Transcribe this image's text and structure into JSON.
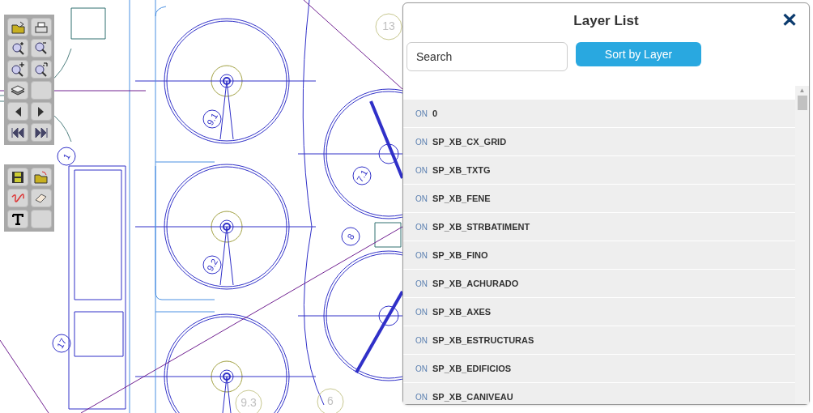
{
  "drawing_labels": [
    {
      "text": "9.1",
      "kind": "circled"
    },
    {
      "text": "9.2",
      "kind": "circled"
    },
    {
      "text": "9.3",
      "kind": "faint"
    },
    {
      "text": "7.1",
      "kind": "circled"
    },
    {
      "text": "8",
      "kind": "circled"
    },
    {
      "text": "1",
      "kind": "circled"
    },
    {
      "text": "17",
      "kind": "circled"
    },
    {
      "text": "13",
      "kind": "faint"
    },
    {
      "text": "6",
      "kind": "faint"
    }
  ],
  "layer_panel": {
    "title": "Layer List",
    "close": "✕",
    "search": {
      "placeholder": "Search"
    },
    "sort_button": "Sort by Layer",
    "scroll_up": "▲",
    "layers": [
      {
        "state": "ON",
        "name": "0"
      },
      {
        "state": "ON",
        "name": "SP_XB_CX_GRID"
      },
      {
        "state": "ON",
        "name": "SP_XB_TXTG"
      },
      {
        "state": "ON",
        "name": "SP_XB_FENE"
      },
      {
        "state": "ON",
        "name": "SP_XB_STRBATIMENT"
      },
      {
        "state": "ON",
        "name": "SP_XB_FINO"
      },
      {
        "state": "ON",
        "name": "SP_XB_ACHURADO"
      },
      {
        "state": "ON",
        "name": "SP_XB_AXES"
      },
      {
        "state": "ON",
        "name": "SP_XB_ESTRUCTURAS"
      },
      {
        "state": "ON",
        "name": "SP_XB_EDIFICIOS"
      },
      {
        "state": "ON",
        "name": "SP_XB_CANIVEAU"
      }
    ]
  }
}
